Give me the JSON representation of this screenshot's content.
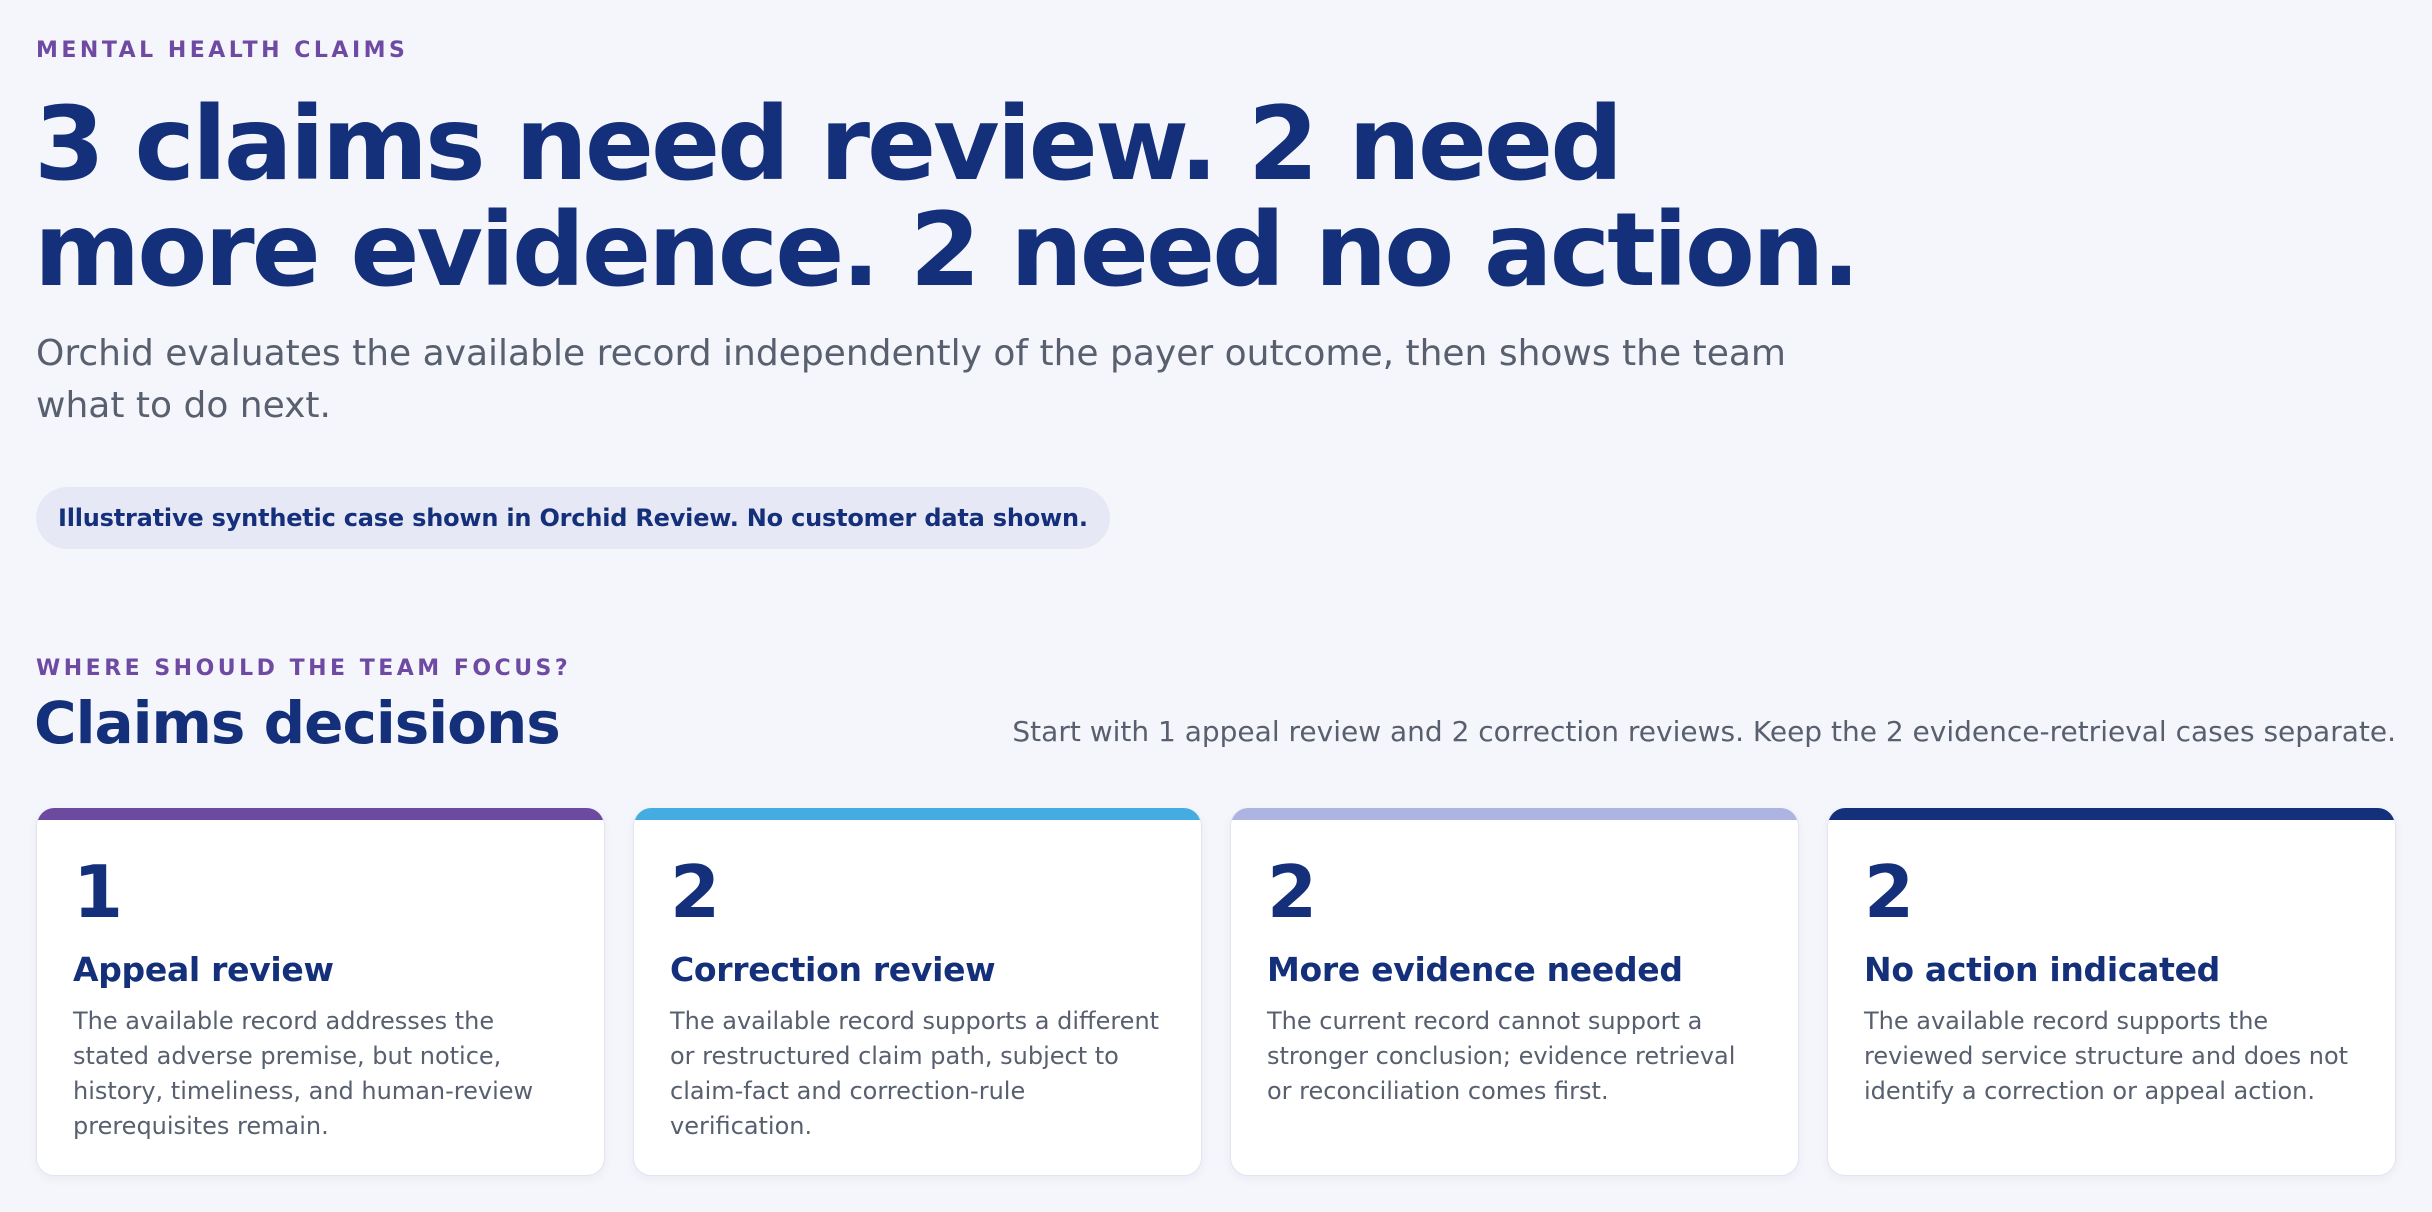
{
  "header": {
    "eyebrow": "MENTAL HEALTH CLAIMS",
    "headline": "3 claims need review. 2 need more evidence. 2 need no action.",
    "subhead": "Orchid evaluates the available record independently of the payer outcome, then shows the team what to do next.",
    "notice": "Illustrative synthetic case shown in Orchid Review. No customer data shown."
  },
  "section": {
    "eyebrow": "WHERE SHOULD THE TEAM FOCUS?",
    "title": "Claims decisions",
    "guidance": "Start with 1 appeal review and 2 correction reviews. Keep the 2 evidence-retrieval cases separate."
  },
  "cards": [
    {
      "count": "1",
      "title": "Appeal review",
      "description": "The available record addresses the stated adverse premise, but notice, history, timeliness, and human-review prerequisites remain.",
      "accent": "#6c4aa0"
    },
    {
      "count": "2",
      "title": "Correction review",
      "description": "The available record supports a different or restructured claim path, subject to claim-fact and correction-rule verification.",
      "accent": "#45ace2"
    },
    {
      "count": "2",
      "title": "More evidence needed",
      "description": "The current record cannot support a stronger conclusion; evidence retrieval or reconciliation comes first.",
      "accent": "#aeb4e2"
    },
    {
      "count": "2",
      "title": "No action indicated",
      "description": "The available record supports the reviewed service structure and does not identify a correction or appeal action.",
      "accent": "#15307a"
    }
  ]
}
